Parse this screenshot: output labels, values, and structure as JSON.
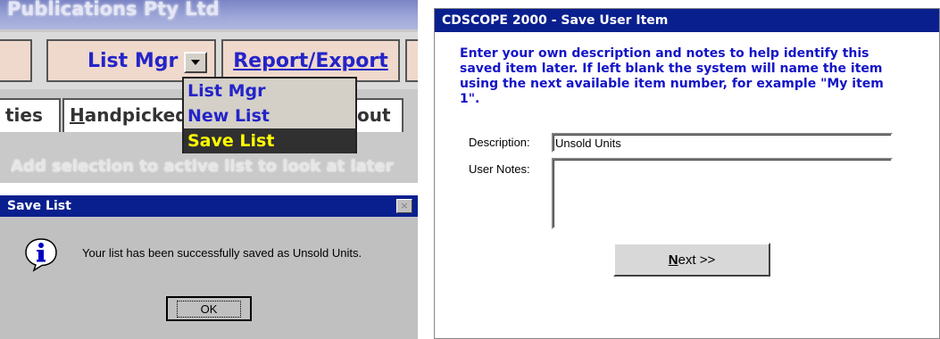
{
  "crop": {
    "title": "Publications Pty Ltd",
    "toolbar": {
      "list_mgr_label": "List Mgr",
      "report_export_label": "Report/Export"
    },
    "tabs": {
      "t1": "ties",
      "t2_prefix": "H",
      "t2_rest": "andpicked",
      "t3": "out"
    },
    "hint": "Add selection to active list to look at later",
    "menu": {
      "items": [
        "List Mgr",
        "New List",
        "Save List"
      ]
    }
  },
  "save_dialog": {
    "title": "Save List",
    "message": "Your list has been successfully saved as Unsold Units.",
    "ok_label": "OK",
    "close_glyph": "×"
  },
  "user_item_dialog": {
    "title": "CDSCOPE 2000 - Save User Item",
    "instructions": "Enter your own description and notes to help identify this saved item later. If left blank the system will name the item using the next available item number, for example \"My item 1\".",
    "description_label": "Description:",
    "description_value": "Unsold Units",
    "notes_label": "User Notes:",
    "notes_value": "",
    "next_label_underlined": "N",
    "next_label_rest": "ext >>"
  },
  "colors": {
    "titlebar": "#0a1f8e",
    "menu_text": "#2424c8",
    "menu_selected_bg": "#303030",
    "menu_selected_text": "#ffff00",
    "instruction_text": "#1414c8"
  },
  "icons": {
    "info": "information-icon",
    "dropdown": "chevron-down-icon",
    "close": "close-icon"
  }
}
